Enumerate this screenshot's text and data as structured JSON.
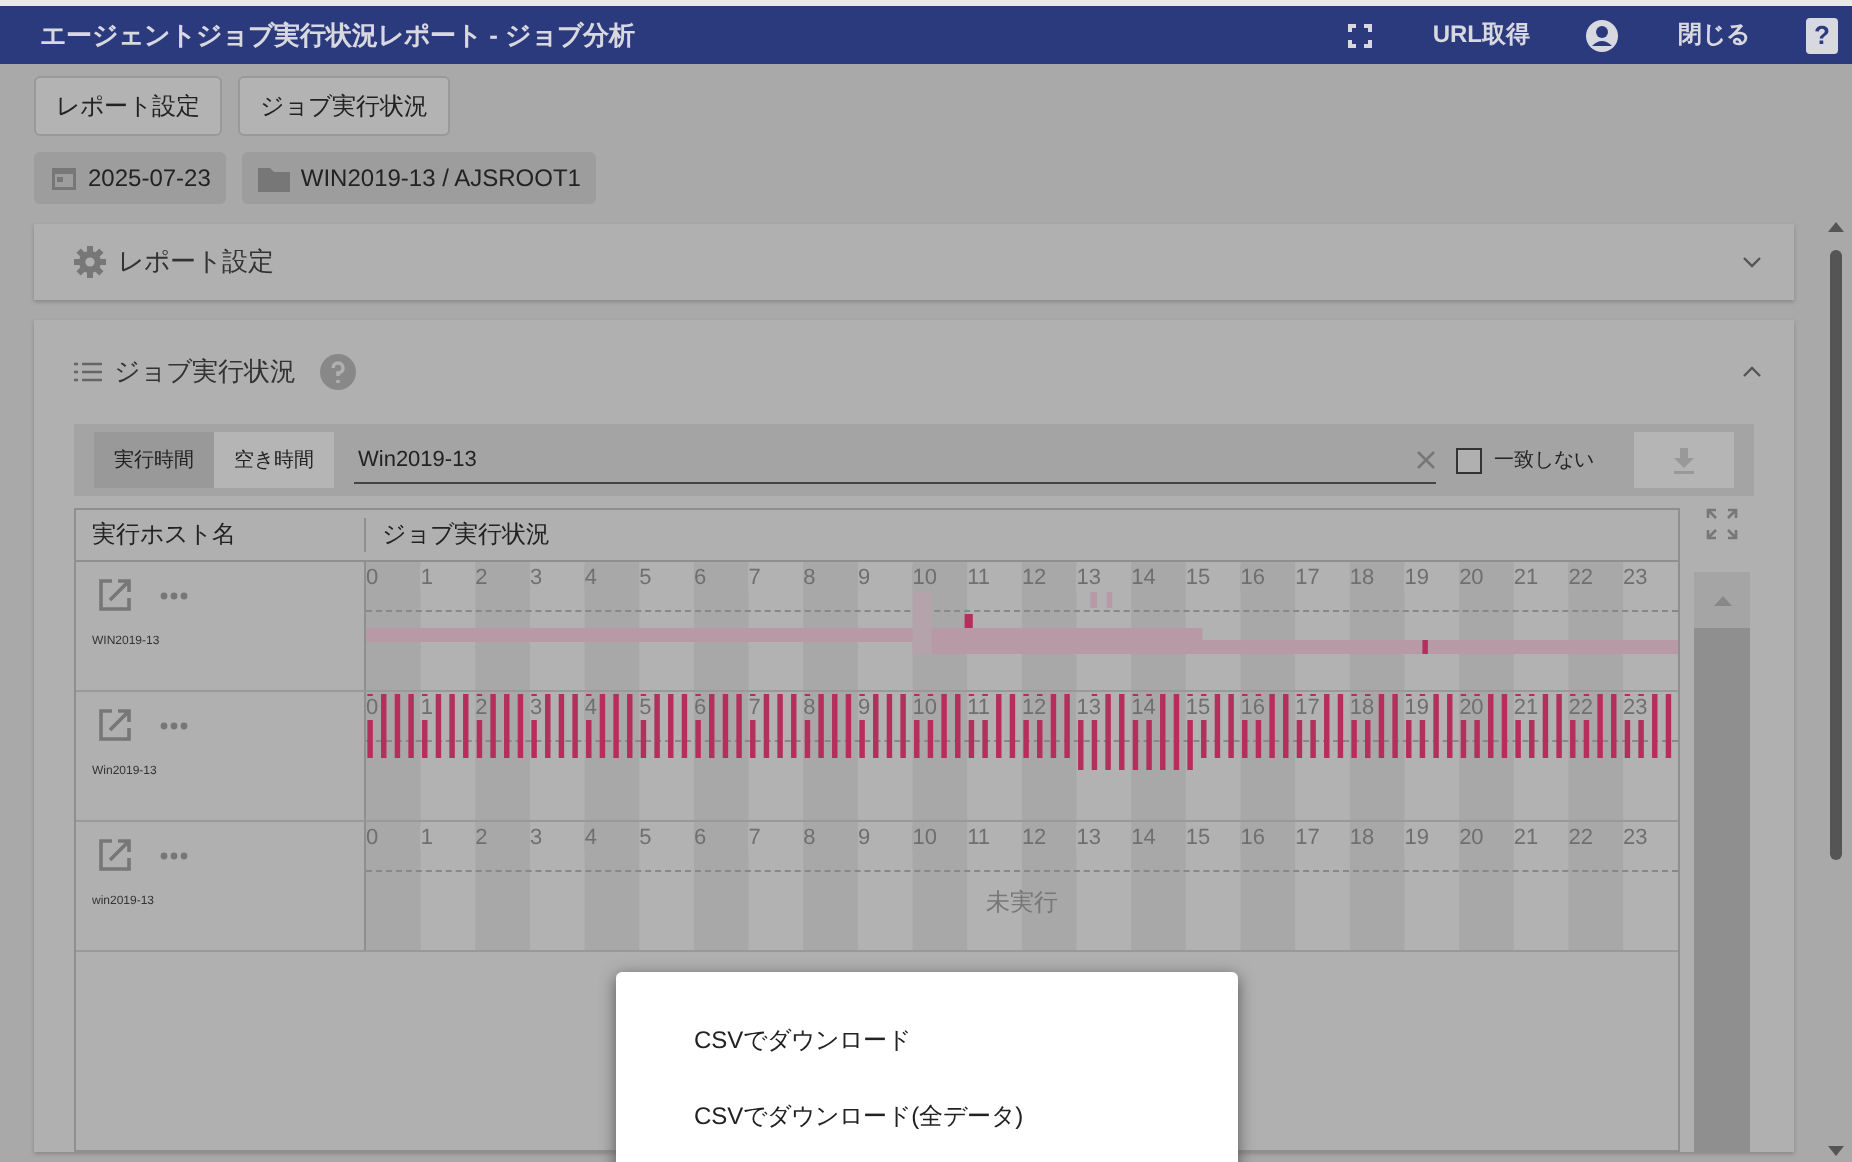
{
  "header": {
    "title": "エージェントジョブ実行状況レポート - ジョブ分析",
    "url_button": "URL取得",
    "close_button": "閉じる",
    "help": "?"
  },
  "top_buttons": [
    "レポート設定",
    "ジョブ実行状況"
  ],
  "chips": [
    {
      "kind": "date",
      "label": "2025-07-23"
    },
    {
      "kind": "folder",
      "label": "WIN2019-13 / AJSROOT1"
    }
  ],
  "report_panel": {
    "title": "レポート設定",
    "expanded": false
  },
  "status_panel": {
    "title": "ジョブ実行状況",
    "expanded": true,
    "modes": [
      {
        "label": "実行時間",
        "selected": true
      },
      {
        "label": "空き時間",
        "selected": false
      }
    ],
    "filter": {
      "value": "Win2019-13"
    },
    "mismatch": {
      "label": "一致しない",
      "checked": false
    },
    "table": {
      "columns": [
        "実行ホスト名",
        "ジョブ実行状況"
      ],
      "rows": [
        {
          "host": "WIN2019-13",
          "kind": "sparse",
          "hours": [
            "0",
            "1",
            "2",
            "3",
            "4",
            "5",
            "6",
            "7",
            "8",
            "9",
            "10",
            "11",
            "12",
            "13",
            "14",
            "15",
            "16",
            "17",
            "18",
            "19",
            "20",
            "21",
            "22",
            "23"
          ]
        },
        {
          "host": "Win2019-13",
          "kind": "dense",
          "hours": [
            "0",
            "1",
            "2",
            "3",
            "4",
            "5",
            "6",
            "7",
            "8",
            "9",
            "10",
            "11",
            "12",
            "13",
            "14",
            "15",
            "16",
            "17",
            "18",
            "19",
            "20",
            "21",
            "22",
            "23"
          ]
        },
        {
          "host": "win2019-13",
          "kind": "empty",
          "status": "未実行",
          "hours": [
            "0",
            "1",
            "2",
            "3",
            "4",
            "5",
            "6",
            "7",
            "8",
            "9",
            "10",
            "11",
            "12",
            "13",
            "14",
            "15",
            "16",
            "17",
            "18",
            "19",
            "20",
            "21",
            "22",
            "23"
          ]
        }
      ]
    }
  },
  "menu": [
    "CSVでダウンロード",
    "CSVでダウンロード(全データ)"
  ]
}
